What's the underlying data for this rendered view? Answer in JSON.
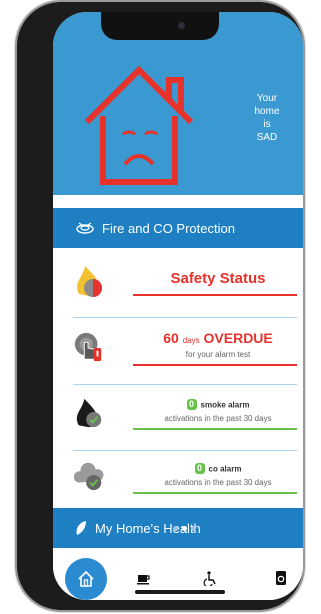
{
  "hero": {
    "mood_lines": [
      "Your",
      "home",
      "is",
      "SAD"
    ]
  },
  "fire_section": {
    "title": "Fire and CO Protection"
  },
  "safety": {
    "title": "Safety Status"
  },
  "overdue": {
    "count": "60",
    "unit": "days",
    "status": "OVERDUE",
    "subtitle": "for your alarm test"
  },
  "smoke": {
    "count": "0",
    "label": "smoke alarm",
    "subtitle": "activations in the past 30 days"
  },
  "co": {
    "count": "0",
    "label": "co alarm",
    "subtitle": "activations in the past 30 days"
  },
  "health_section": {
    "title": "My Home's Health"
  },
  "colors": {
    "hero_blue": "#3a99d0",
    "header_blue": "#1e80c3",
    "alert_red": "#e6322b",
    "ok_green": "#67c04a"
  },
  "icons": [
    "sad-house-icon",
    "fire-badge-icon",
    "smoke-detector-icon",
    "alarm-touch-icon",
    "flame-check-icon",
    "cloud-check-icon",
    "leaf-icon",
    "home-tab-icon",
    "coffee-tab-icon",
    "accessibility-tab-icon",
    "appliance-tab-icon"
  ]
}
